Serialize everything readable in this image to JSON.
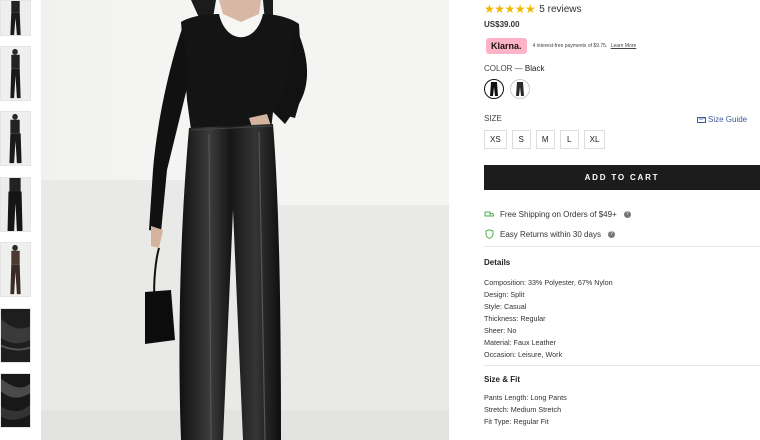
{
  "gallery": {
    "thumbnails": [
      "thumbnail-full-body-front",
      "thumbnail-full-body-side",
      "thumbnail-full-body-back",
      "thumbnail-side-detail",
      "thumbnail-brown-variant",
      "thumbnail-fabric-detail",
      "thumbnail-fabric-closeup"
    ]
  },
  "product": {
    "stars": "★★★★★",
    "reviews": "5 reviews",
    "price": "US$39.00",
    "klarna": {
      "logo": "Klarna.",
      "text": "4 interest-free payments of $9.75.",
      "link": "Learn More"
    },
    "color": {
      "label": "COLOR",
      "separator": " — ",
      "value": "Black"
    },
    "size": {
      "label": "SIZE",
      "guide": "Size Guide",
      "options": [
        "XS",
        "S",
        "M",
        "L",
        "XL"
      ]
    },
    "add_to_cart": "ADD TO CART",
    "perks": {
      "shipping": "Free Shipping on Orders of $49+",
      "returns": "Easy Returns within 30 days"
    },
    "details": {
      "title": "Details",
      "items": [
        "Composition: 33% Polyester, 67% Nylon",
        "Design: Split",
        "Style: Casual",
        "Thickness: Regular",
        "Sheer: No",
        "Material: Faux Leather",
        "Occasion: Leisure, Work"
      ]
    },
    "size_fit": {
      "title": "Size & Fit",
      "items": [
        "Pants Length: Long Pants",
        "Stretch: Medium Stretch",
        "Fit Type: Regular Fit"
      ]
    }
  },
  "colors": {
    "star": "#f2b800",
    "klarna_pink": "#ffb3c7",
    "button_bg": "#1c1c1c",
    "perk_green": "#4caf50"
  }
}
